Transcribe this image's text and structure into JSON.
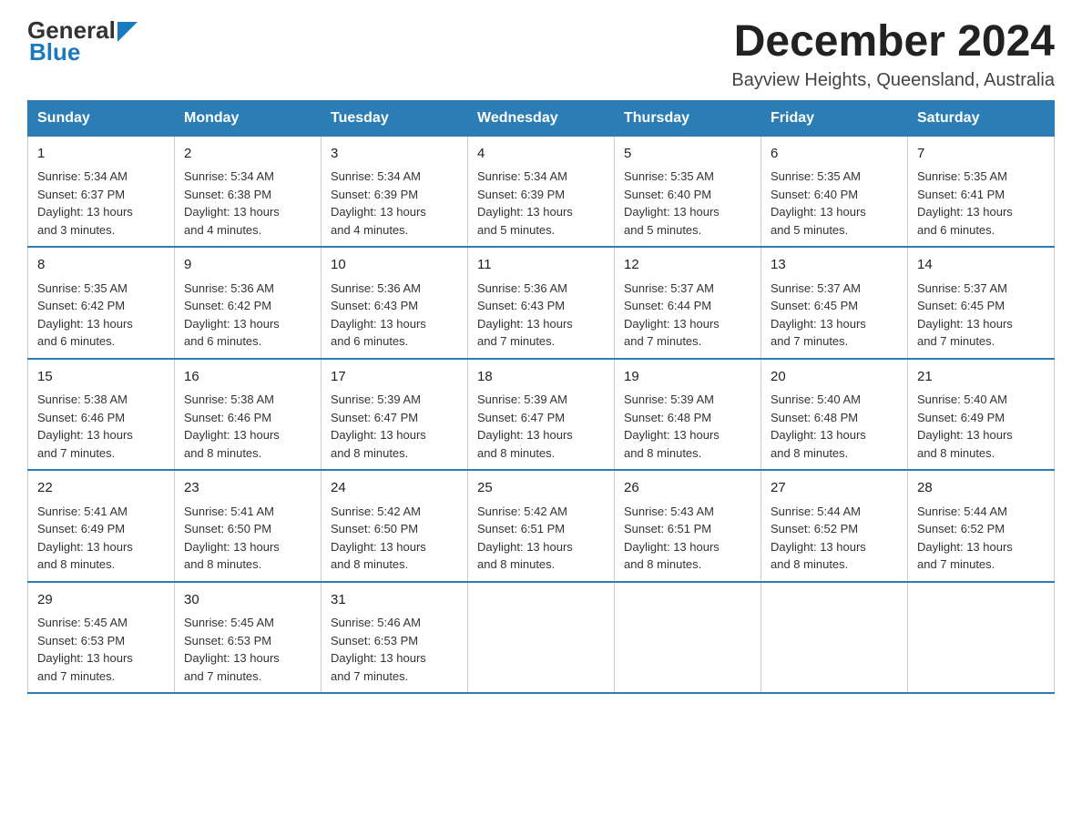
{
  "header": {
    "logo_general": "General",
    "logo_blue": "Blue",
    "month_title": "December 2024",
    "location": "Bayview Heights, Queensland, Australia"
  },
  "days_of_week": [
    "Sunday",
    "Monday",
    "Tuesday",
    "Wednesday",
    "Thursday",
    "Friday",
    "Saturday"
  ],
  "weeks": [
    [
      {
        "day": "1",
        "sunrise": "5:34 AM",
        "sunset": "6:37 PM",
        "daylight": "13 hours and 3 minutes."
      },
      {
        "day": "2",
        "sunrise": "5:34 AM",
        "sunset": "6:38 PM",
        "daylight": "13 hours and 4 minutes."
      },
      {
        "day": "3",
        "sunrise": "5:34 AM",
        "sunset": "6:39 PM",
        "daylight": "13 hours and 4 minutes."
      },
      {
        "day": "4",
        "sunrise": "5:34 AM",
        "sunset": "6:39 PM",
        "daylight": "13 hours and 5 minutes."
      },
      {
        "day": "5",
        "sunrise": "5:35 AM",
        "sunset": "6:40 PM",
        "daylight": "13 hours and 5 minutes."
      },
      {
        "day": "6",
        "sunrise": "5:35 AM",
        "sunset": "6:40 PM",
        "daylight": "13 hours and 5 minutes."
      },
      {
        "day": "7",
        "sunrise": "5:35 AM",
        "sunset": "6:41 PM",
        "daylight": "13 hours and 6 minutes."
      }
    ],
    [
      {
        "day": "8",
        "sunrise": "5:35 AM",
        "sunset": "6:42 PM",
        "daylight": "13 hours and 6 minutes."
      },
      {
        "day": "9",
        "sunrise": "5:36 AM",
        "sunset": "6:42 PM",
        "daylight": "13 hours and 6 minutes."
      },
      {
        "day": "10",
        "sunrise": "5:36 AM",
        "sunset": "6:43 PM",
        "daylight": "13 hours and 6 minutes."
      },
      {
        "day": "11",
        "sunrise": "5:36 AM",
        "sunset": "6:43 PM",
        "daylight": "13 hours and 7 minutes."
      },
      {
        "day": "12",
        "sunrise": "5:37 AM",
        "sunset": "6:44 PM",
        "daylight": "13 hours and 7 minutes."
      },
      {
        "day": "13",
        "sunrise": "5:37 AM",
        "sunset": "6:45 PM",
        "daylight": "13 hours and 7 minutes."
      },
      {
        "day": "14",
        "sunrise": "5:37 AM",
        "sunset": "6:45 PM",
        "daylight": "13 hours and 7 minutes."
      }
    ],
    [
      {
        "day": "15",
        "sunrise": "5:38 AM",
        "sunset": "6:46 PM",
        "daylight": "13 hours and 7 minutes."
      },
      {
        "day": "16",
        "sunrise": "5:38 AM",
        "sunset": "6:46 PM",
        "daylight": "13 hours and 8 minutes."
      },
      {
        "day": "17",
        "sunrise": "5:39 AM",
        "sunset": "6:47 PM",
        "daylight": "13 hours and 8 minutes."
      },
      {
        "day": "18",
        "sunrise": "5:39 AM",
        "sunset": "6:47 PM",
        "daylight": "13 hours and 8 minutes."
      },
      {
        "day": "19",
        "sunrise": "5:39 AM",
        "sunset": "6:48 PM",
        "daylight": "13 hours and 8 minutes."
      },
      {
        "day": "20",
        "sunrise": "5:40 AM",
        "sunset": "6:48 PM",
        "daylight": "13 hours and 8 minutes."
      },
      {
        "day": "21",
        "sunrise": "5:40 AM",
        "sunset": "6:49 PM",
        "daylight": "13 hours and 8 minutes."
      }
    ],
    [
      {
        "day": "22",
        "sunrise": "5:41 AM",
        "sunset": "6:49 PM",
        "daylight": "13 hours and 8 minutes."
      },
      {
        "day": "23",
        "sunrise": "5:41 AM",
        "sunset": "6:50 PM",
        "daylight": "13 hours and 8 minutes."
      },
      {
        "day": "24",
        "sunrise": "5:42 AM",
        "sunset": "6:50 PM",
        "daylight": "13 hours and 8 minutes."
      },
      {
        "day": "25",
        "sunrise": "5:42 AM",
        "sunset": "6:51 PM",
        "daylight": "13 hours and 8 minutes."
      },
      {
        "day": "26",
        "sunrise": "5:43 AM",
        "sunset": "6:51 PM",
        "daylight": "13 hours and 8 minutes."
      },
      {
        "day": "27",
        "sunrise": "5:44 AM",
        "sunset": "6:52 PM",
        "daylight": "13 hours and 8 minutes."
      },
      {
        "day": "28",
        "sunrise": "5:44 AM",
        "sunset": "6:52 PM",
        "daylight": "13 hours and 7 minutes."
      }
    ],
    [
      {
        "day": "29",
        "sunrise": "5:45 AM",
        "sunset": "6:53 PM",
        "daylight": "13 hours and 7 minutes."
      },
      {
        "day": "30",
        "sunrise": "5:45 AM",
        "sunset": "6:53 PM",
        "daylight": "13 hours and 7 minutes."
      },
      {
        "day": "31",
        "sunrise": "5:46 AM",
        "sunset": "6:53 PM",
        "daylight": "13 hours and 7 minutes."
      },
      null,
      null,
      null,
      null
    ]
  ],
  "labels": {
    "sunrise": "Sunrise:",
    "sunset": "Sunset:",
    "daylight": "Daylight:"
  }
}
